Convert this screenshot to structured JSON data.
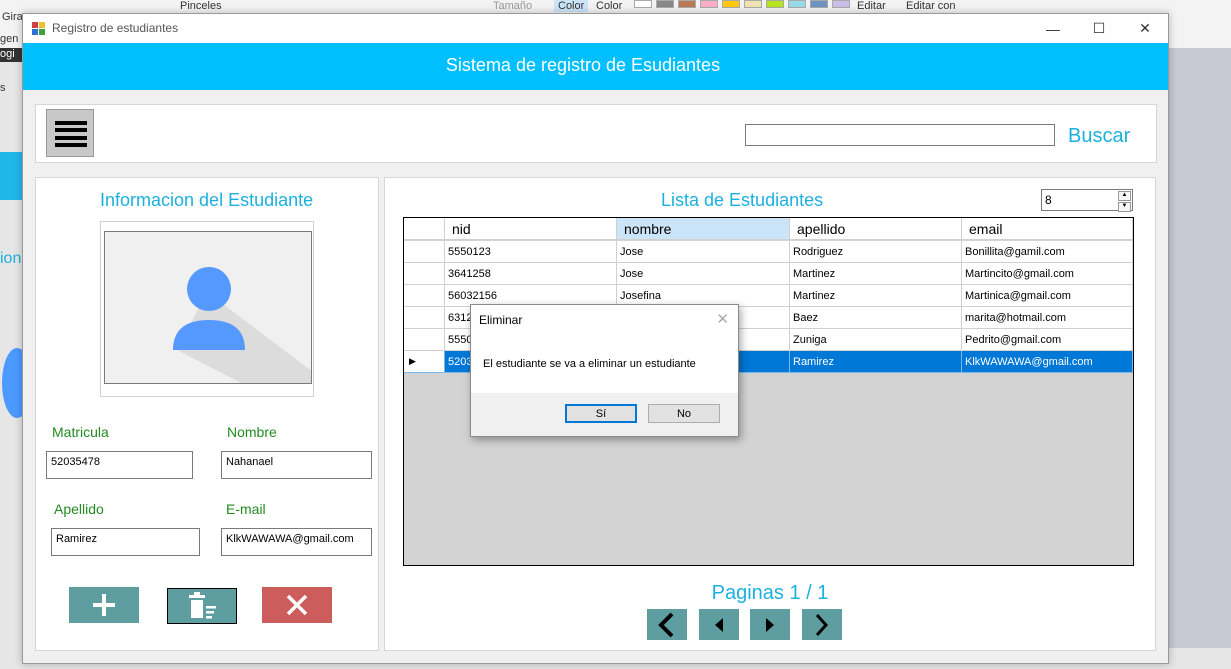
{
  "background": {
    "ribbon_labels": [
      "Gira",
      "gen",
      "Pinceles",
      "Tamaño",
      "Color",
      "Color",
      "Editar",
      "Editar con"
    ],
    "sidebar_fragments": [
      "ogi",
      "s",
      "ion"
    ]
  },
  "window": {
    "title": "Registro de estudiantes",
    "minimize_glyph": "—",
    "maximize_glyph": "☐",
    "close_glyph": "✕"
  },
  "header": {
    "title": "Sistema de registro de Esudiantes"
  },
  "search": {
    "value": "",
    "button_label": "Buscar"
  },
  "student_info": {
    "title": "Informacion del Estudiante",
    "fields": {
      "matricula": {
        "label": "Matricula",
        "value": "52035478"
      },
      "nombre": {
        "label": "Nombre",
        "value": "Nahanael"
      },
      "apellido": {
        "label": "Apellido",
        "value": "Ramirez"
      },
      "email": {
        "label": "E-mail",
        "value": "KlkWAWAWA@gmail.com"
      }
    },
    "actions": {
      "add_color": "#5f9ea0",
      "delete_color": "#5f9ea0",
      "cancel_color": "#cd5c5c"
    }
  },
  "student_list": {
    "title": "Lista de Estudiantes",
    "page_size": "8",
    "columns": [
      "nid",
      "nombre",
      "apellido",
      "email"
    ],
    "rows": [
      [
        "5550123",
        "Jose",
        "Rodriguez",
        "Bonillita@gamil.com"
      ],
      [
        "3641258",
        "Jose",
        "Martinez",
        "Martincito@gmail.com"
      ],
      [
        "56032156",
        "Josefina",
        "Martinez",
        "Martinica@gmail.com"
      ],
      [
        "6312",
        "",
        "Baez",
        "marita@hotmail.com"
      ],
      [
        "5550",
        "",
        "Zuniga",
        "Pedrito@gmail.com"
      ],
      [
        "5203",
        "",
        "Ramirez",
        "KlkWAWAWA@gmail.com"
      ]
    ],
    "selected_row": 5,
    "pagination_text": "Paginas 1 / 1"
  },
  "dialog": {
    "title": "Eliminar",
    "close_glyph": "✕",
    "message": "El estudiante se va a eliminar un estudiante",
    "yes_label": "Sí",
    "no_label": "No"
  },
  "colors": {
    "accent": "#00bfff",
    "label_green": "#228b22",
    "selection": "#0078d7"
  }
}
